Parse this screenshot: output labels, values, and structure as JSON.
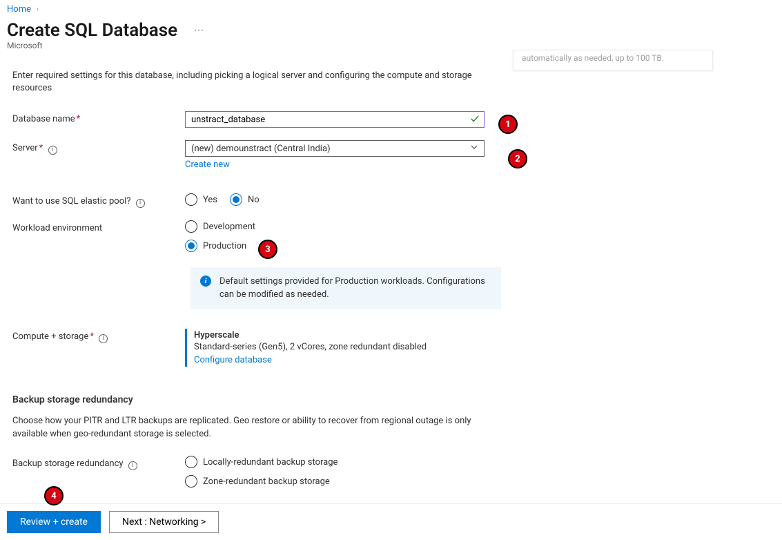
{
  "breadcrumb": {
    "home": "Home"
  },
  "header": {
    "title": "Create SQL Database",
    "vendor": "Microsoft"
  },
  "intro": "Enter required settings for this database, including picking a logical server and configuring the compute and storage resources",
  "labels": {
    "db_name": "Database name",
    "server": "Server",
    "elastic": "Want to use SQL elastic pool?",
    "workload": "Workload environment",
    "compute": "Compute + storage",
    "backup_section": "Backup storage redundancy",
    "backup_desc": "Choose how your PITR and LTR backups are replicated. Geo restore or ability to recover from regional outage is only available when geo-redundant storage is selected.",
    "backup_label": "Backup storage redundancy"
  },
  "form": {
    "db_name": "unstract_database",
    "server_value": "(new) demounstract (Central India)",
    "create_new": "Create new",
    "elastic": {
      "yes": "Yes",
      "no": "No",
      "selected": "no"
    },
    "workload": {
      "dev": "Development",
      "prod": "Production",
      "selected": "prod"
    },
    "info_box": "Default settings provided for Production workloads. Configurations can be modified as needed.",
    "compute": {
      "tier": "Hyperscale",
      "spec": "Standard-series (Gen5), 2 vCores, zone redundant disabled",
      "link": "Configure database"
    },
    "backup_options": {
      "local": "Locally-redundant backup storage",
      "zone": "Zone-redundant backup storage"
    }
  },
  "footer": {
    "review": "Review + create",
    "next": "Next : Networking >"
  },
  "float_card": "automatically as needed, up to 100 TB.",
  "callouts": {
    "c1": "1",
    "c2": "2",
    "c3": "3",
    "c4": "4"
  }
}
